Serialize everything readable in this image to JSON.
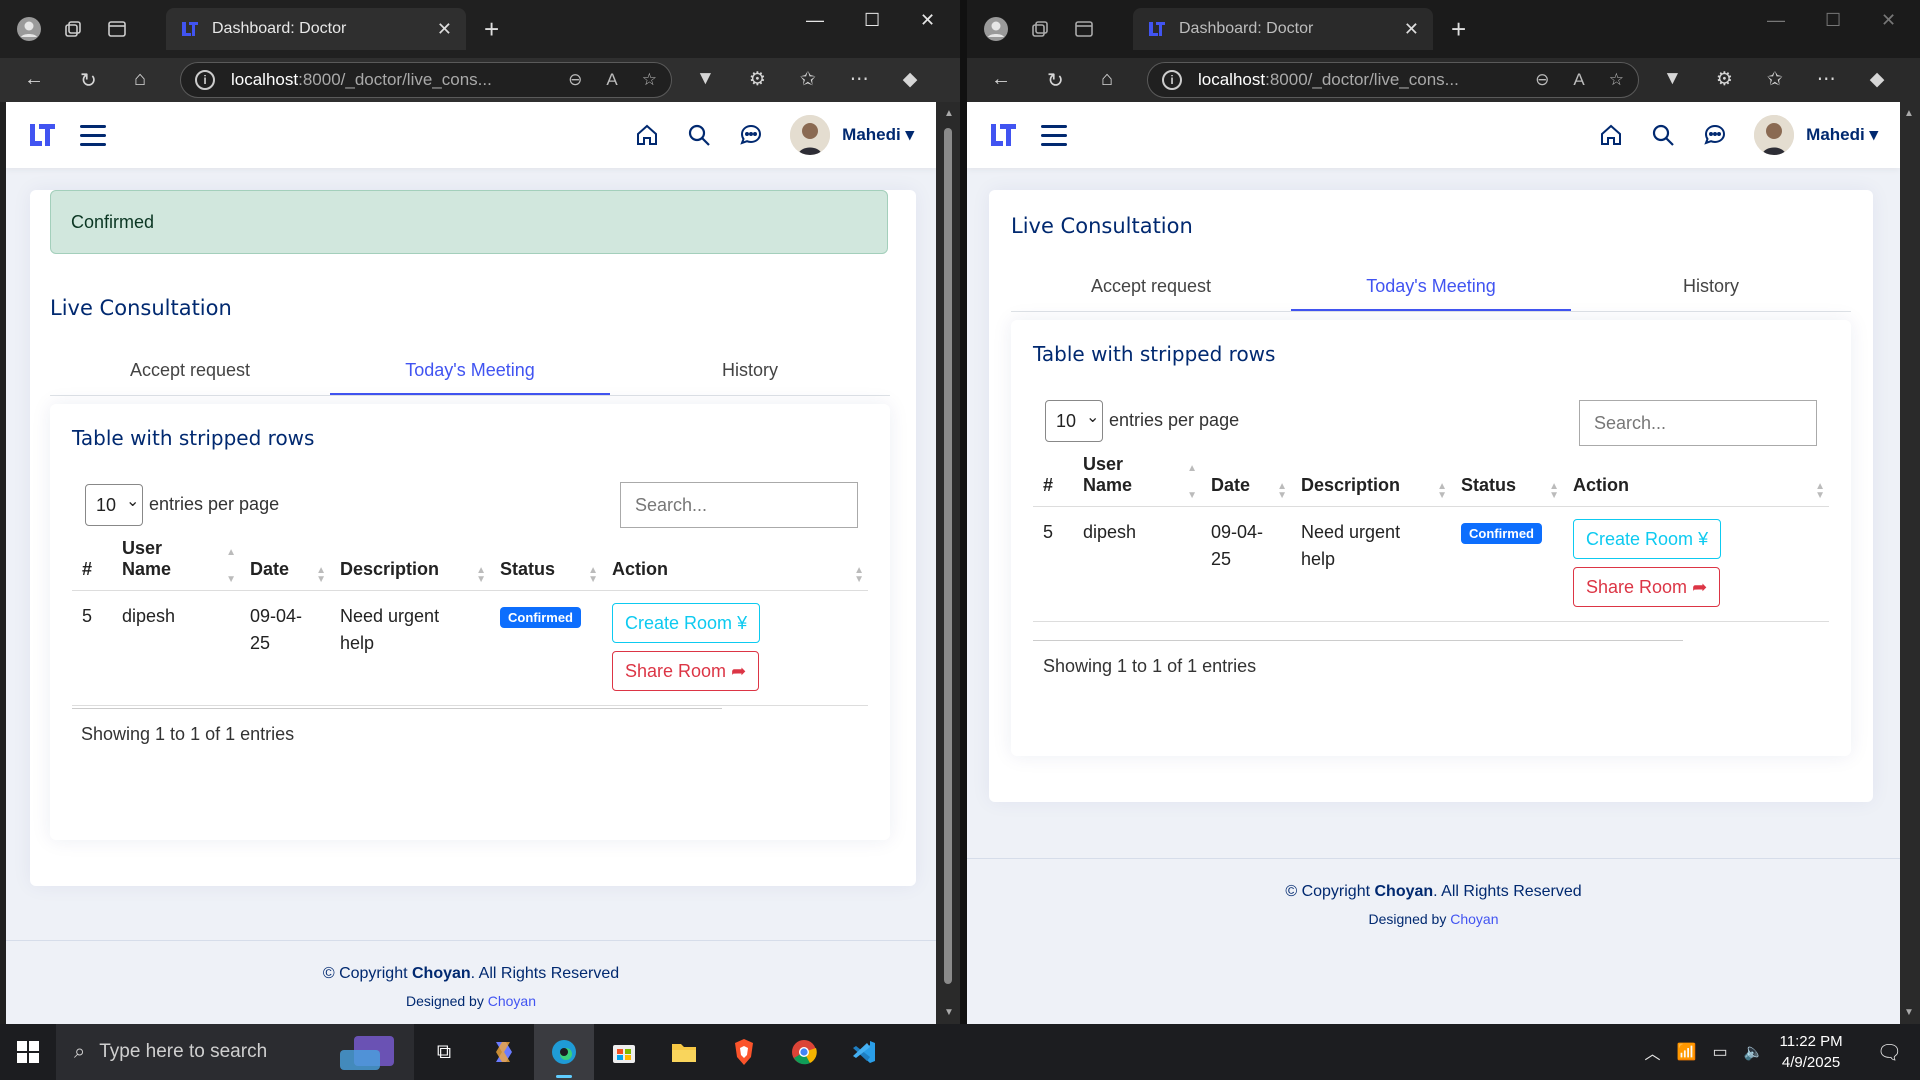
{
  "browser": {
    "tab_title": "Dashboard: Doctor",
    "url_host": "localhost",
    "url_path": ":8000/_doctor/live_cons..."
  },
  "app": {
    "user_name": "Mahedi"
  },
  "alert": {
    "text": "Confirmed"
  },
  "card": {
    "title": "Live Consultation",
    "tabs": [
      "Accept request",
      "Today's Meeting",
      "History"
    ],
    "active_tab": 1
  },
  "table_card": {
    "title": "Table with stripped rows",
    "entries_value": "10",
    "entries_label": "entries per page",
    "search_placeholder": "Search...",
    "headers": [
      "#",
      "User Name",
      "Date",
      "Description",
      "Status",
      "Action"
    ],
    "headers_wrapped": {
      "user_name": [
        "User",
        "Name"
      ]
    },
    "rows": [
      {
        "id": "5",
        "user": "dipesh",
        "date_line1": "09-04-",
        "date_line2": "25",
        "desc_line1": "Need urgent",
        "desc_line2": "help",
        "status": "Confirmed",
        "create_label": "Create Room",
        "create_symbol": "¥",
        "share_label": "Share Room",
        "share_symbol": "➦"
      }
    ],
    "showing": "Showing 1 to 1 of 1 entries"
  },
  "footer": {
    "copy_prefix": "© Copyright ",
    "brand": "Choyan",
    "copy_suffix": ". All Rights Reserved",
    "designed_by": "Designed by ",
    "designer": "Choyan"
  },
  "taskbar": {
    "search_placeholder": "Type here to search",
    "time": "11:22 PM",
    "date": "4/9/2025"
  },
  "colors": {
    "primary": "#4154f1",
    "navy": "#012970",
    "badge": "#0d6efd",
    "create_btn": "#0dcaf0",
    "share_btn": "#dc3545",
    "alert_bg": "#d1e7dd"
  }
}
